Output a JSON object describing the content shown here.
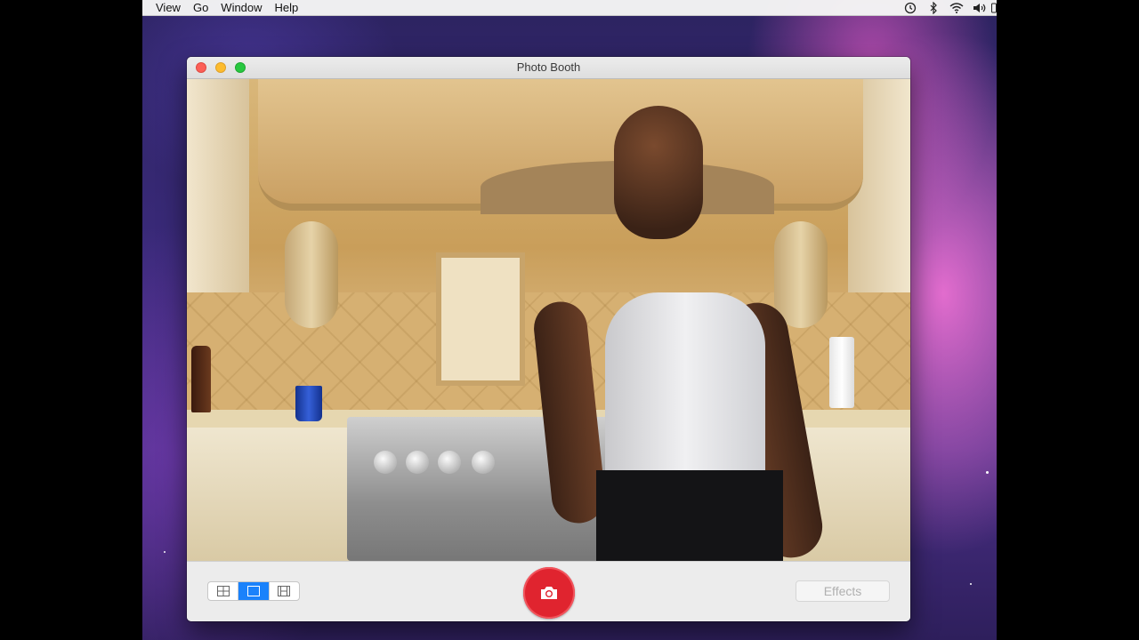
{
  "menubar": {
    "items": [
      "View",
      "Go",
      "Window",
      "Help"
    ],
    "status_icons": [
      "time-machine-icon",
      "bluetooth-icon",
      "wifi-icon",
      "volume-icon",
      "battery-icon"
    ]
  },
  "window": {
    "title": "Photo Booth",
    "traffic_colors": {
      "close": "#fc5f57",
      "minimize": "#fdbc2e",
      "zoom": "#28c840"
    }
  },
  "toolbar": {
    "view_modes": [
      {
        "icon": "grid-four-icon",
        "active": false
      },
      {
        "icon": "single-photo-icon",
        "active": true
      },
      {
        "icon": "filmstrip-icon",
        "active": false
      }
    ],
    "shutter_icon": "camera-icon",
    "shutter_color": "#e0242f",
    "effects_label": "Effects"
  },
  "accent_color": "#1a82fb"
}
